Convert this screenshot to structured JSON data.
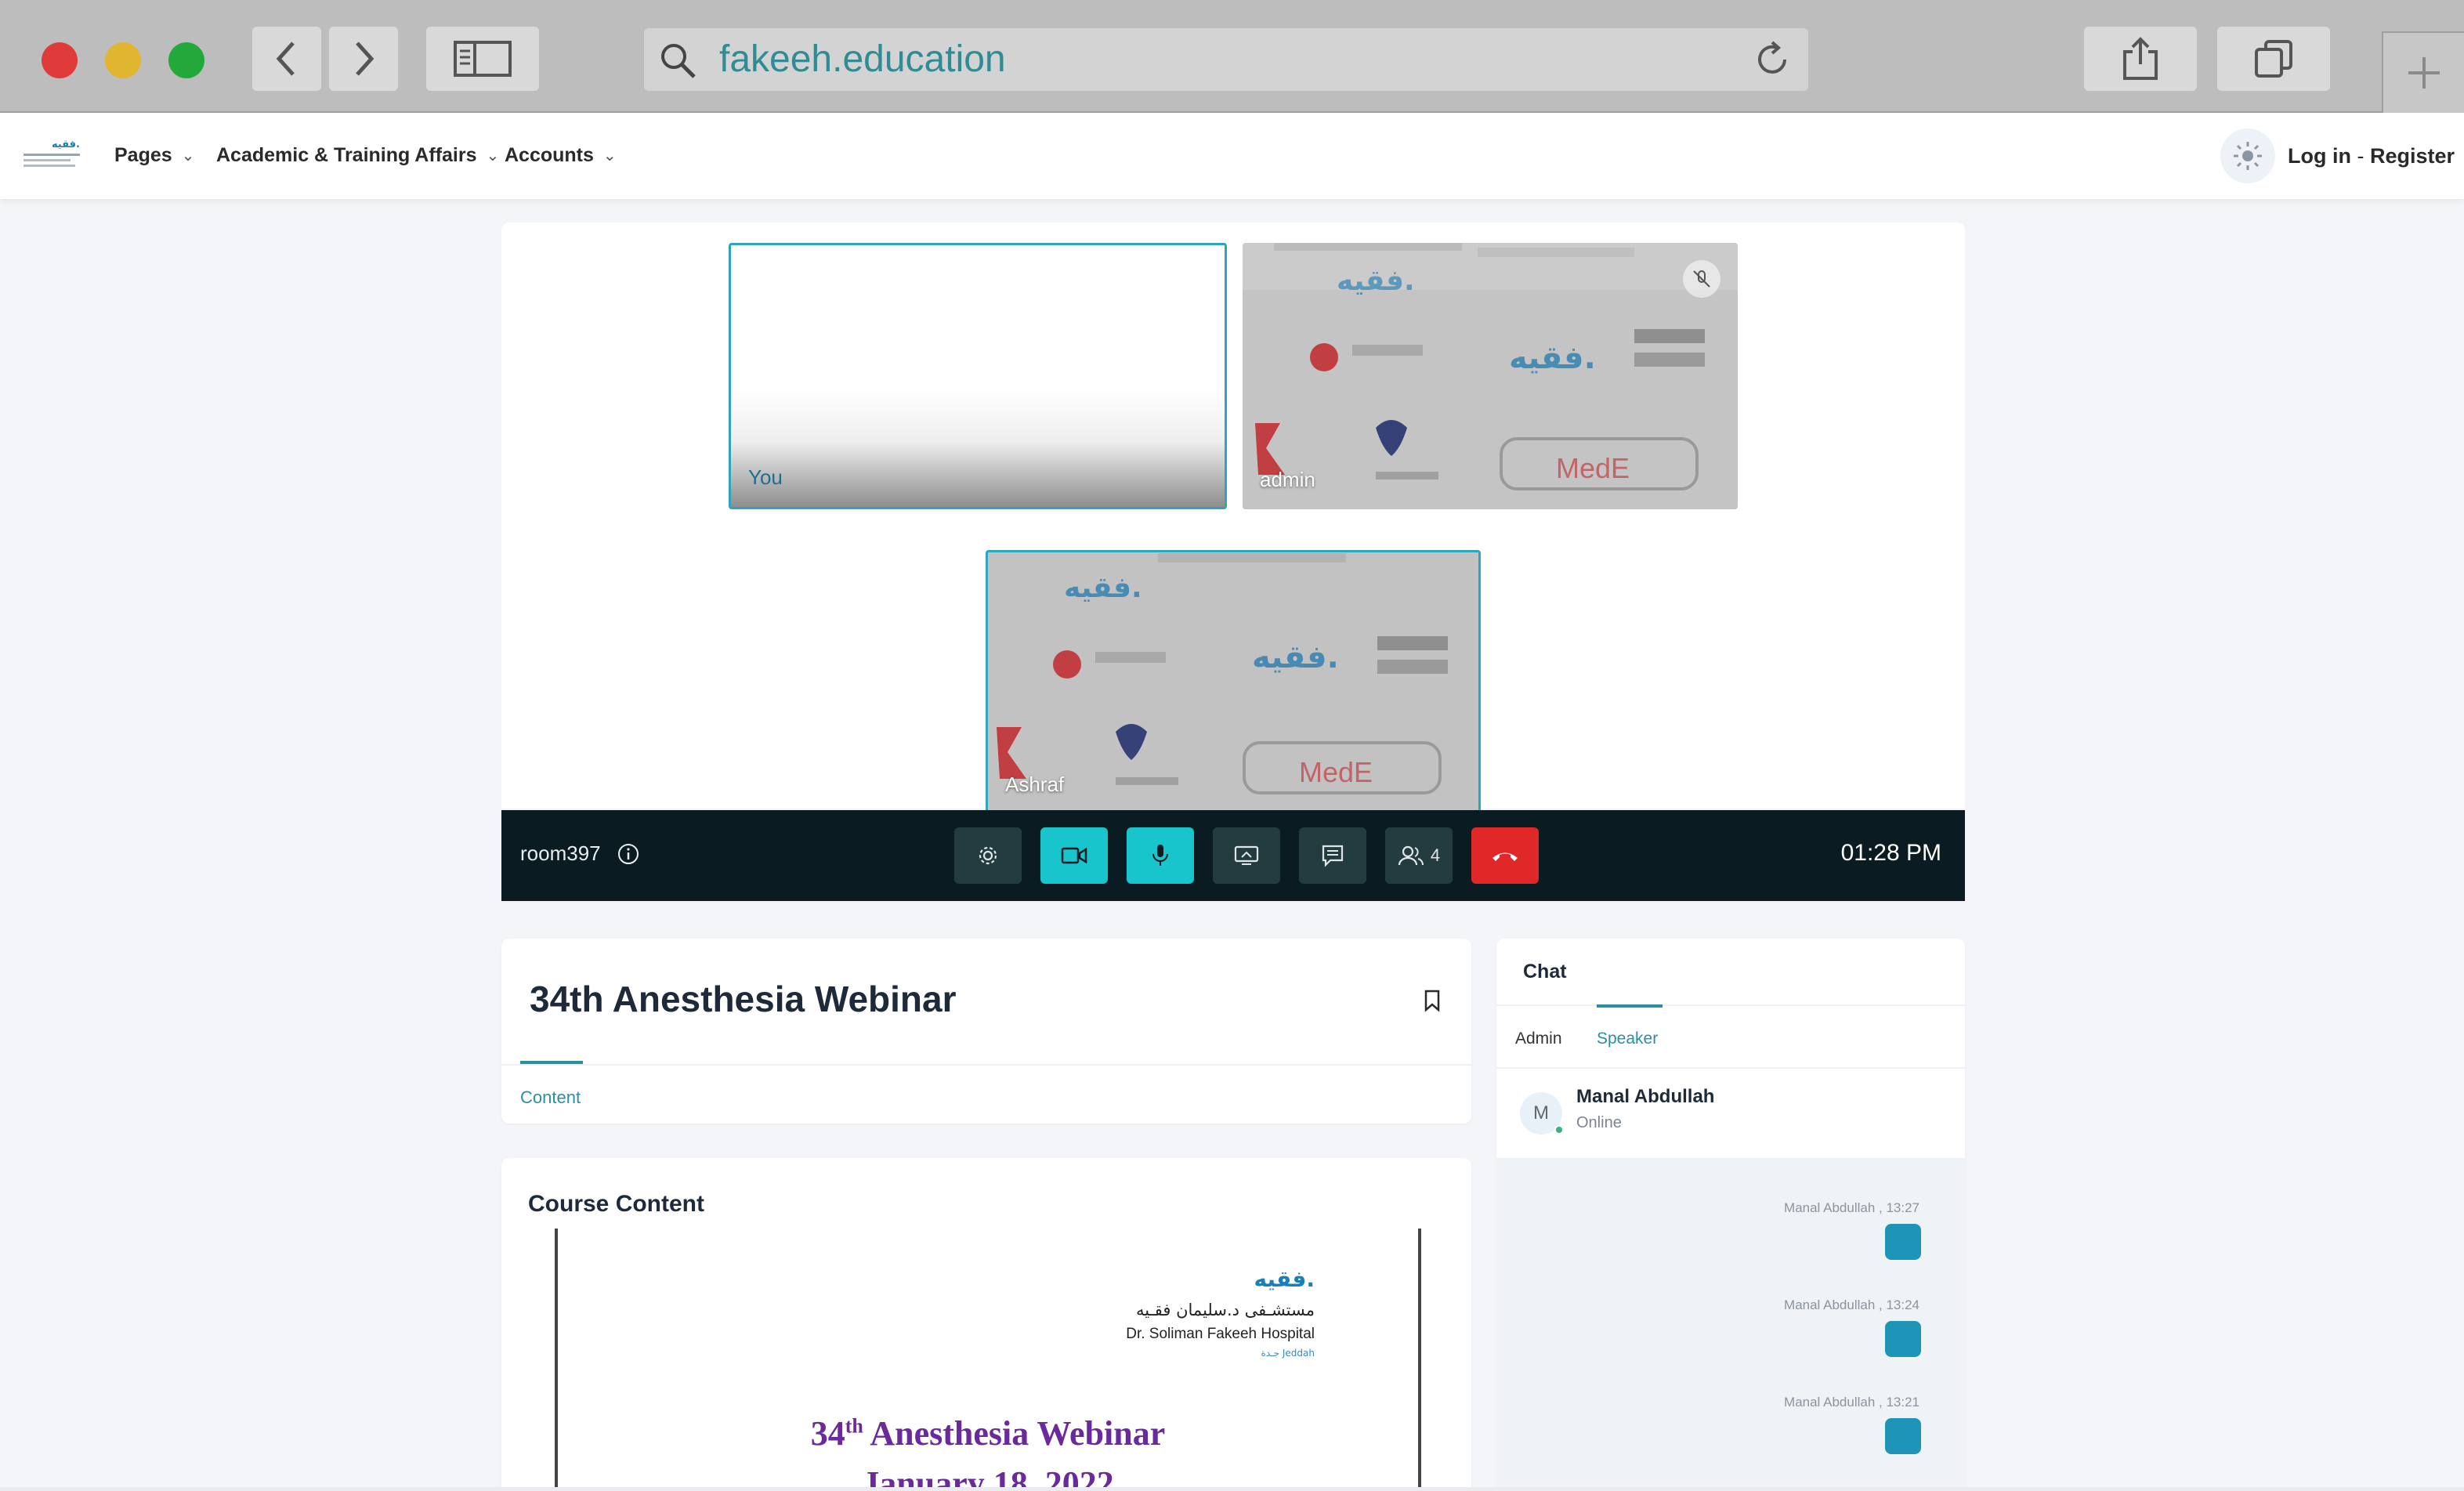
{
  "browser": {
    "url": "fakeeh.education"
  },
  "nav": {
    "items": [
      {
        "label": "Pages"
      },
      {
        "label": "Academic & Training Affairs"
      },
      {
        "label": "Accounts"
      }
    ],
    "login": "Log in",
    "separator": "-",
    "register": "Register"
  },
  "video": {
    "tiles": [
      {
        "name": "You"
      },
      {
        "name": "admin"
      },
      {
        "name": "Ashraf"
      }
    ],
    "room": "room397",
    "participants_count": "4",
    "time": "01:28 PM",
    "colors": {
      "teal": "#18c5cc",
      "end_call": "#e02828",
      "bar": "#0a1c22"
    }
  },
  "course": {
    "title": "34th Anesthesia Webinar",
    "tab": "Content",
    "content_heading": "Course Content",
    "document": {
      "logo": "فقيه.",
      "hospital_ar": "مستشـفى د.سليمان فقـيه",
      "hospital_en": "Dr. Soliman Fakeeh Hospital",
      "city": "جـدة Jeddah",
      "title_num": "34",
      "title_sup": "th",
      "title_rest": " Anesthesia Webinar",
      "date_partial": "January 18, 2022"
    }
  },
  "chat": {
    "title": "Chat",
    "tabs": [
      "Admin",
      "Speaker"
    ],
    "user": {
      "initial": "M",
      "name": "Manal Abdullah",
      "status": "Online"
    },
    "messages": [
      {
        "meta": "Manal Abdullah , 13:27"
      },
      {
        "meta": "Manal Abdullah , 13:24"
      },
      {
        "meta": "Manal Abdullah , 13:21"
      }
    ]
  }
}
